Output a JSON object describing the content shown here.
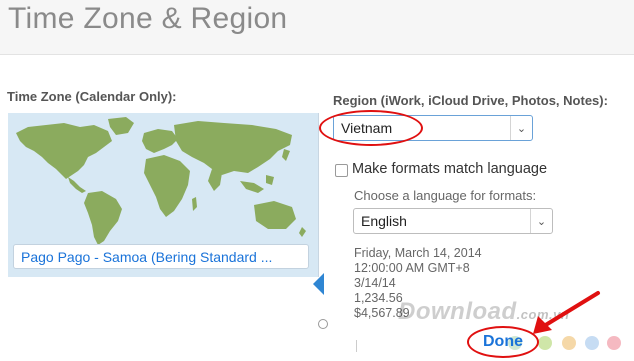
{
  "header": {
    "title": "Time Zone & Region"
  },
  "time_zone": {
    "label": "Time Zone (Calendar Only):",
    "selected": "Pago Pago - Samoa (Bering Standard ..."
  },
  "region": {
    "label": "Region (iWork, iCloud Drive, Photos, Notes):",
    "value": "Vietnam"
  },
  "formats": {
    "match_language_label": "Make formats match language",
    "match_language_checked": false,
    "choose_language_label": "Choose a language for formats:",
    "language_value": "English",
    "samples": [
      "Friday, March 14, 2014",
      "12:00:00 AM GMT+8",
      "3/14/14",
      "1,234.56",
      "$4,567.89"
    ]
  },
  "footer": {
    "done_label": "Done"
  },
  "watermark": {
    "text": "Download",
    "suffix": ".com.vn"
  },
  "colors": {
    "accent": "#1a73d9",
    "annotation": "#e01010",
    "map_land": "#8bab5e",
    "map_sea": "#d7e8f4",
    "dots": [
      "#cfe8d2",
      "#cfe6a8",
      "#f5d8a8",
      "#c6dcf3",
      "#f5b9c1"
    ]
  },
  "icons": {
    "select_chevron": "chevron-down-icon",
    "pointer_arrow": "red-arrow-icon"
  }
}
